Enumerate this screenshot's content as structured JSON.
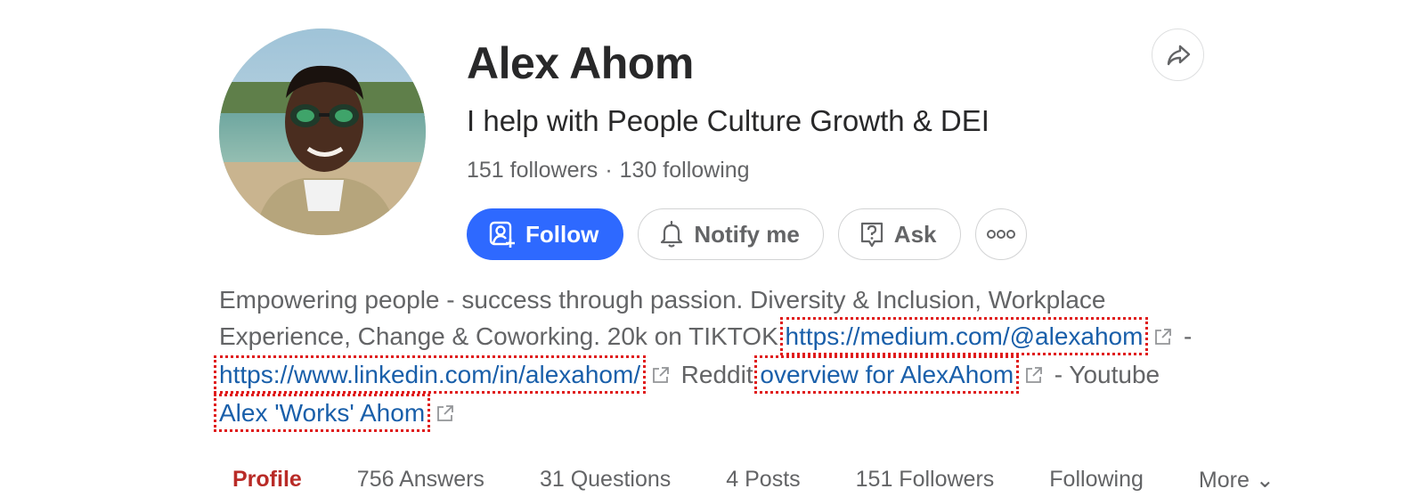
{
  "profile": {
    "name": "Alex Ahom",
    "tagline": "I help with People Culture Growth & DEI",
    "followers": "151 followers",
    "separator": "·",
    "following": "130 following"
  },
  "actions": {
    "follow": "Follow",
    "notify": "Notify me",
    "ask": "Ask",
    "more_icon": "more-dots-icon",
    "share_icon": "share-arrow-icon"
  },
  "bio": {
    "text1": "Empowering people - success through passion. Diversity & Inclusion, Workplace Experience, Change & Coworking. 20k on TIKTOK",
    "link1": "https://medium.com/@alexahom",
    "sep1": "-",
    "link2": "https://www.linkedin.com/in/alexahom/",
    "text2": "Reddit",
    "link3": "overview for AlexAhom",
    "sep2": "-",
    "text3": "Youtube",
    "link4": "Alex 'Works' Ahom"
  },
  "tabs": [
    {
      "label": "Profile",
      "active": true
    },
    {
      "label": "756 Answers"
    },
    {
      "label": "31 Questions"
    },
    {
      "label": "4 Posts"
    },
    {
      "label": "151 Followers"
    },
    {
      "label": "Following"
    },
    {
      "label": "More"
    }
  ],
  "colors": {
    "accent": "#2e69ff",
    "link": "#195faa",
    "active_tab": "#b92b27",
    "annotation": "#e01b1b"
  }
}
